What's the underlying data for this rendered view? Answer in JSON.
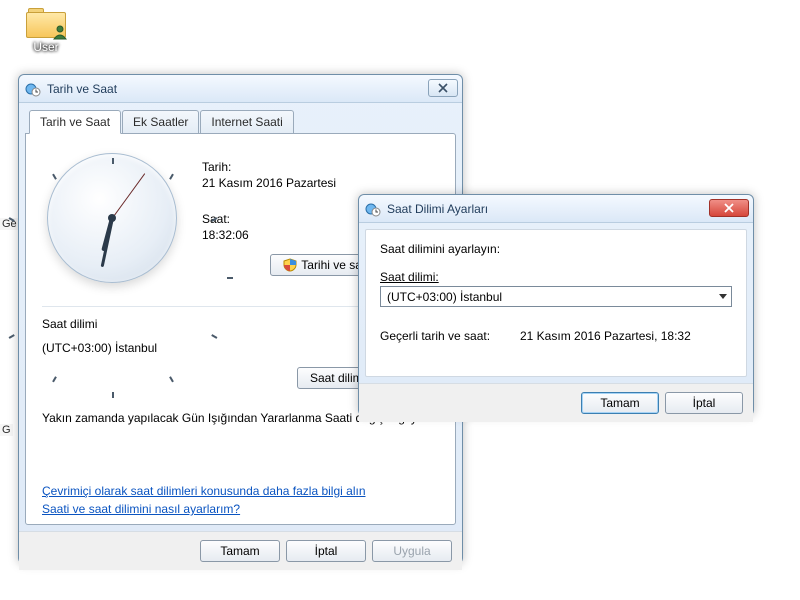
{
  "desktop": {
    "user_icon_label": "User"
  },
  "edges": {
    "g_top": "Ge",
    "g_bot": "G"
  },
  "datetime_dialog": {
    "window_title": "Tarih ve Saat",
    "tabs": {
      "datetime": "Tarih ve Saat",
      "additional": "Ek Saatler",
      "internet": "Internet Saati"
    },
    "date_label": "Tarih:",
    "date_value": "21 Kasım 2016 Pazartesi",
    "time_label": "Saat:",
    "time_value": "18:32:06",
    "change_datetime_btn": "Tarihi ve saati değiştir...",
    "tz_section_label": "Saat dilimi",
    "tz_value": "(UTC+03:00) İstanbul",
    "change_tz_btn": "Saat dilimini değiştir...",
    "dst_note": "Yakın zamanda yapılacak Gün Işığından Yararlanma Saati değişikliği yok.",
    "link_online": "Çevrimiçi olarak saat dilimleri konusunda daha fazla bilgi alın",
    "link_howto": "Saati ve saat dilimini nasıl ayarlarım?",
    "ok": "Tamam",
    "cancel": "İptal",
    "apply": "Uygula"
  },
  "tz_dialog": {
    "window_title": "Saat Dilimi Ayarları",
    "instruction": "Saat dilimini ayarlayın:",
    "field_label": "Saat dilimi:",
    "selected": "(UTC+03:00) İstanbul",
    "current_label": "Geçerli tarih ve saat:",
    "current_value": "21 Kasım 2016 Pazartesi, 18:32",
    "ok": "Tamam",
    "cancel": "İptal"
  },
  "clock": {
    "hour_angle": 195,
    "minute_angle": 192,
    "second_angle": 36
  }
}
